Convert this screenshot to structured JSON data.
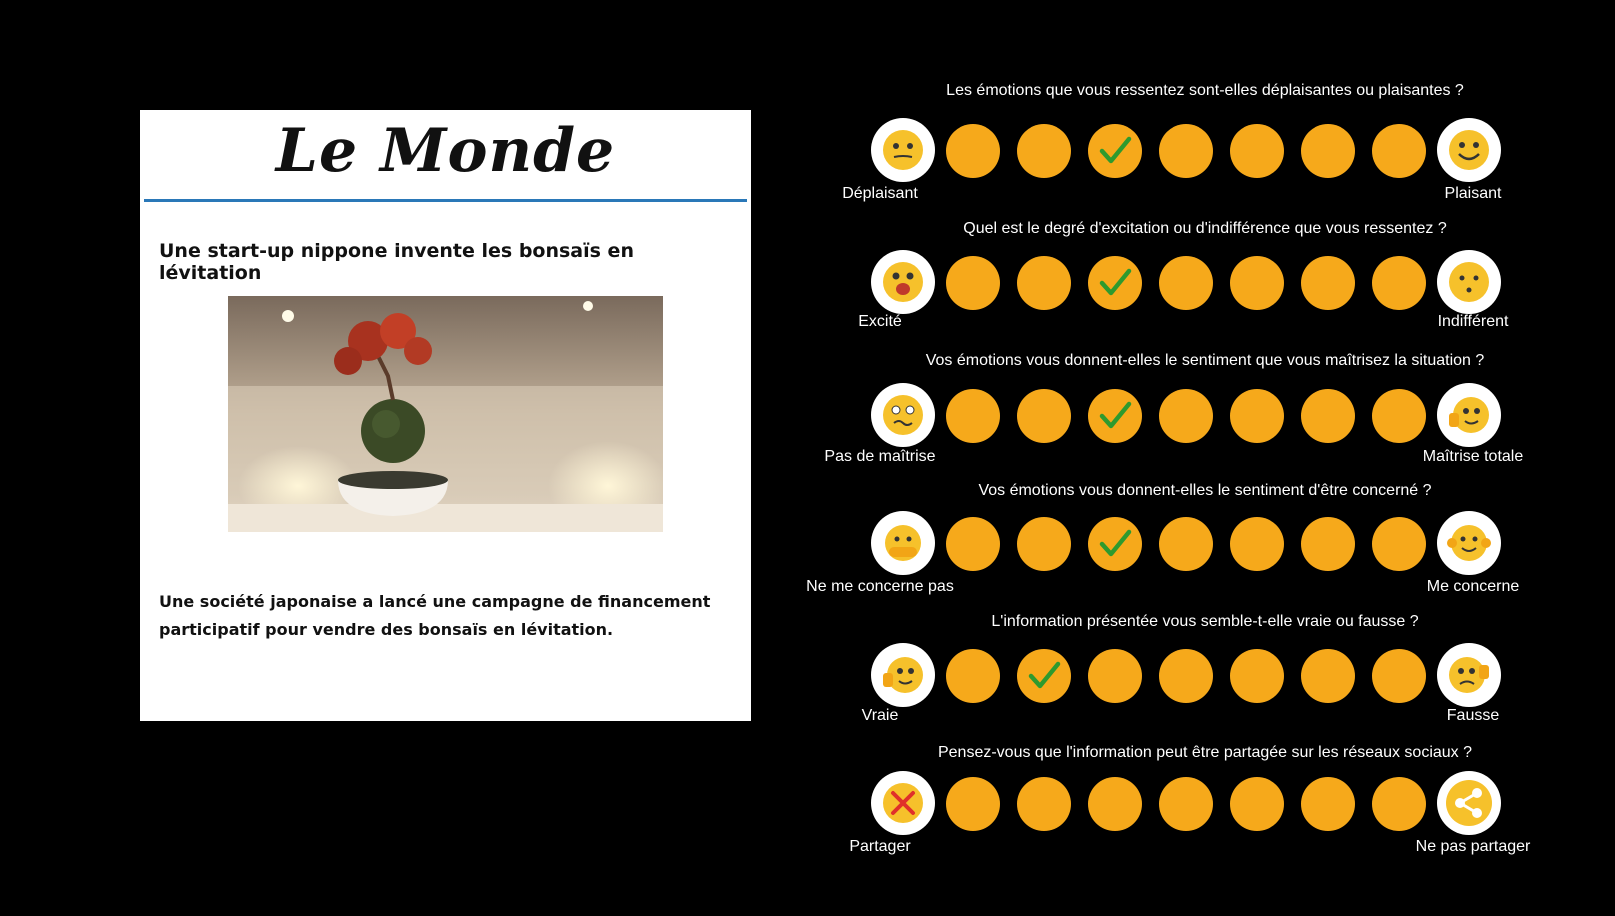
{
  "article": {
    "logo": "Le Monde",
    "headline": "Une start-up nippone invente les bonsaïs en lévitation",
    "summary": "Une société japonaise a lancé une campagne de financement participatif pour vendre des bonsaïs en lévitation."
  },
  "colors": {
    "accent": "#f6a91b",
    "check": "#2e9a2e",
    "rule": "#2a78b8"
  },
  "scales": [
    {
      "question": "Les émotions que vous ressentez sont-elles déplaisantes ou plaisantes ?",
      "left_label": "Déplaisant",
      "right_label": "Plaisant",
      "left_icon": "neutral-face-icon",
      "right_icon": "smile-face-icon",
      "selected": 3
    },
    {
      "question": "Quel est le degré d'excitation ou d'indifférence que vous ressentez ?",
      "left_label": "Excité",
      "right_label": "Indifférent",
      "left_icon": "excited-face-icon",
      "right_icon": "indifferent-face-icon",
      "selected": 3
    },
    {
      "question": "Vos émotions vous donnent-elles le sentiment que vous maîtrisez la situation ?",
      "left_label": "Pas de maîtrise",
      "right_label": "Maîtrise totale",
      "left_icon": "confused-face-icon",
      "right_icon": "thumbs-up-face-icon",
      "selected": 3
    },
    {
      "question": "Vos émotions vous donnent-elles le sentiment d'être concerné ?",
      "left_label": "Ne me concerne pas",
      "right_label": "Me concerne",
      "left_icon": "hiding-face-icon",
      "right_icon": "waving-face-icon",
      "selected": 3
    },
    {
      "question": "L'information présentée vous semble-t-elle vraie ou fausse ?",
      "left_label": "Vraie",
      "right_label": "Fausse",
      "left_icon": "thumbs-up-face-icon",
      "right_icon": "thumbs-down-face-icon",
      "selected": 2
    },
    {
      "question": "Pensez-vous que l'information peut être partagée sur les réseaux sociaux ?",
      "left_label": "Partager",
      "right_label": "Ne pas partager",
      "left_icon": "cross-icon",
      "right_icon": "share-icon",
      "selected": null
    }
  ]
}
